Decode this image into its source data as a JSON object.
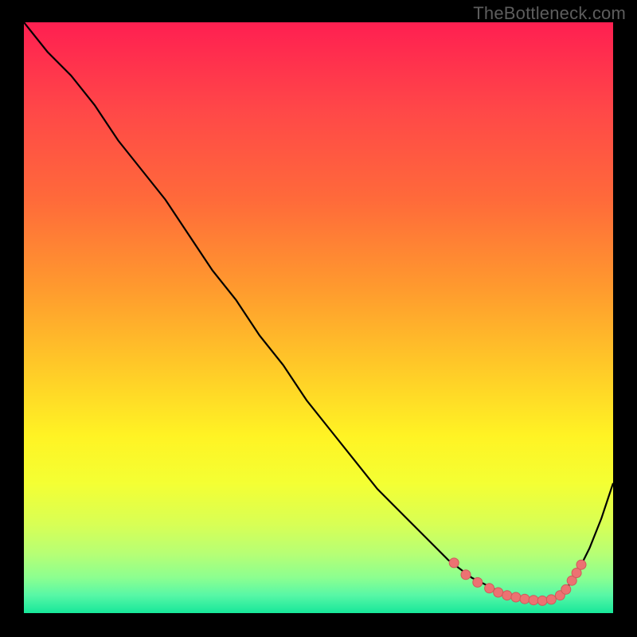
{
  "watermark": "TheBottleneck.com",
  "colors": {
    "page_bg": "#000000",
    "line": "#000000",
    "marker_fill": "#ec7272",
    "marker_stroke": "#cf5a5a",
    "gradient_stops": [
      {
        "offset": 0.0,
        "color": "#ff1f51"
      },
      {
        "offset": 0.15,
        "color": "#ff4848"
      },
      {
        "offset": 0.3,
        "color": "#ff6a3a"
      },
      {
        "offset": 0.45,
        "color": "#ff9a2e"
      },
      {
        "offset": 0.58,
        "color": "#ffc828"
      },
      {
        "offset": 0.7,
        "color": "#fff324"
      },
      {
        "offset": 0.78,
        "color": "#f4ff33"
      },
      {
        "offset": 0.85,
        "color": "#d8ff55"
      },
      {
        "offset": 0.9,
        "color": "#b6ff75"
      },
      {
        "offset": 0.94,
        "color": "#8cff90"
      },
      {
        "offset": 0.97,
        "color": "#57f7a6"
      },
      {
        "offset": 1.0,
        "color": "#17e79a"
      }
    ]
  },
  "chart_data": {
    "type": "line",
    "title": "",
    "xlabel": "",
    "ylabel": "",
    "xlim": [
      0,
      100
    ],
    "ylim": [
      0,
      100
    ],
    "grid": false,
    "series": [
      {
        "name": "curve",
        "x": [
          0,
          4,
          8,
          12,
          16,
          20,
          24,
          28,
          32,
          36,
          40,
          44,
          48,
          52,
          56,
          60,
          64,
          68,
          72,
          76,
          80,
          82,
          84,
          86,
          88,
          90,
          92,
          94,
          96,
          98,
          100
        ],
        "y": [
          100,
          95,
          91,
          86,
          80,
          75,
          70,
          64,
          58,
          53,
          47,
          42,
          36,
          31,
          26,
          21,
          17,
          13,
          9,
          6,
          4,
          3,
          2.5,
          2.2,
          2,
          2.5,
          4,
          7,
          11,
          16,
          22
        ]
      }
    ],
    "markers": {
      "name": "highlight-points",
      "x": [
        73,
        75,
        77,
        79,
        80.5,
        82,
        83.5,
        85,
        86.5,
        88,
        89.5,
        91,
        92,
        93,
        93.8,
        94.6
      ],
      "y": [
        8.5,
        6.5,
        5.2,
        4.2,
        3.5,
        3.0,
        2.7,
        2.4,
        2.2,
        2.1,
        2.3,
        3.0,
        4.0,
        5.5,
        6.8,
        8.2
      ]
    }
  }
}
